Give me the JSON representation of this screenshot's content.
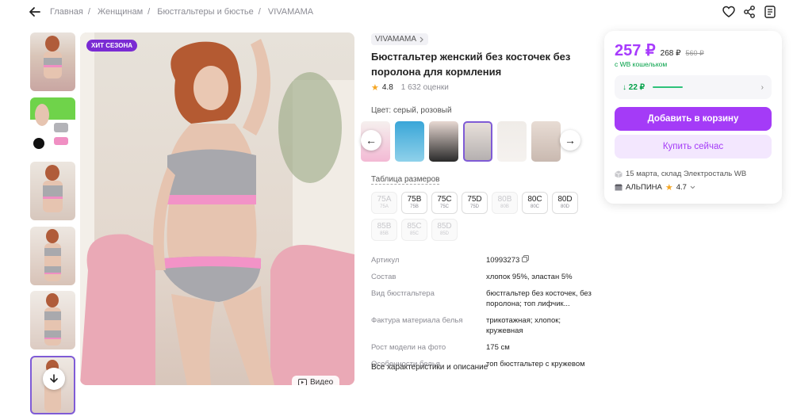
{
  "breadcrumbs": [
    "Главная",
    "Женщинам",
    "Бюстгальтеры и бюстье",
    "VIVAMAMA"
  ],
  "badge": "ХИТ СЕЗОНА",
  "video_label": "Видео",
  "brand": "VIVAMAMA",
  "title": "Бюстгальтер женский без косточек без поролона для кормления",
  "rating": "4.8",
  "reviews": "1 632 оценки",
  "color_label": "Цвет: серый, розовый",
  "sizes_link": "Таблица размеров",
  "sizes": [
    {
      "a": "75A",
      "b": "75A",
      "disabled": true
    },
    {
      "a": "75B",
      "b": "75B",
      "disabled": false
    },
    {
      "a": "75C",
      "b": "75C",
      "disabled": false
    },
    {
      "a": "75D",
      "b": "75D",
      "disabled": false
    },
    {
      "a": "80B",
      "b": "80B",
      "disabled": true
    },
    {
      "a": "80C",
      "b": "80C",
      "disabled": false
    },
    {
      "a": "80D",
      "b": "80D",
      "disabled": false
    },
    {
      "a": "85B",
      "b": "85B",
      "disabled": true
    },
    {
      "a": "85C",
      "b": "85C",
      "disabled": true
    },
    {
      "a": "85D",
      "b": "85D",
      "disabled": true
    }
  ],
  "specs": [
    {
      "k": "Артикул",
      "v": "10993273"
    },
    {
      "k": "Состав",
      "v": "хлопок 95%, эластан 5%"
    },
    {
      "k": "Вид бюстгальтера",
      "v": "бюстгальтер без косточек, без поролона; топ лифчик..."
    },
    {
      "k": "Фактура материала белья",
      "v": "трикотажная; хлопок; кружевная"
    },
    {
      "k": "Рост модели на фото",
      "v": "175 см"
    },
    {
      "k": "Особенности белья",
      "v": "топ бюстгальтер с кружевом"
    }
  ],
  "all_chars": "Все характеристики и описание",
  "price": {
    "main": "257 ₽",
    "old": "268 ₽",
    "strike": "560 ₽",
    "wallet": "с WB кошельком"
  },
  "cashback": "↓ 22 ₽",
  "add_to_cart": "Добавить в корзину",
  "buy_now": "Купить сейчас",
  "delivery": "15 марта, склад Электросталь WB",
  "seller": {
    "name": "АЛЬПИНА",
    "rating": "4.7"
  }
}
